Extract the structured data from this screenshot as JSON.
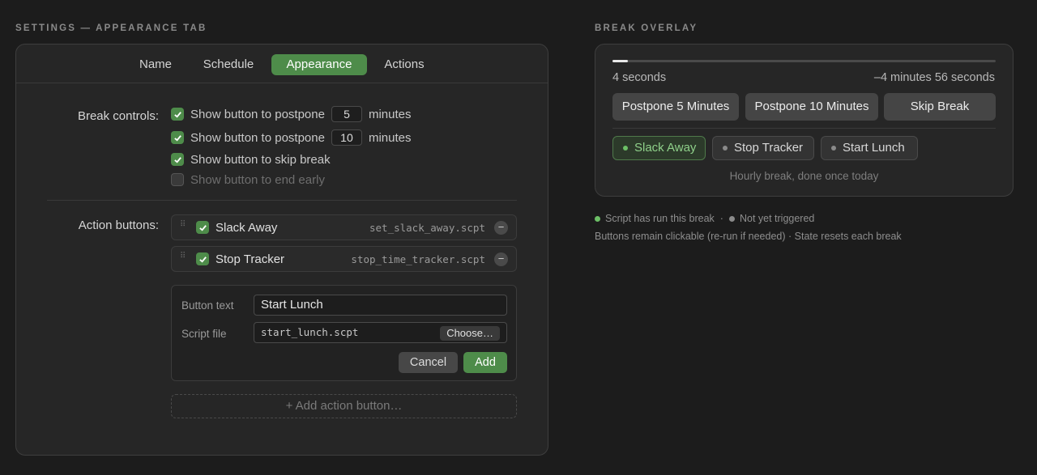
{
  "settings": {
    "section_title": "SETTINGS — APPEARANCE TAB",
    "tabs": [
      {
        "label": "Name"
      },
      {
        "label": "Schedule"
      },
      {
        "label": "Appearance",
        "active": true
      },
      {
        "label": "Actions"
      }
    ],
    "break_controls": {
      "label": "Break controls:",
      "rows": [
        {
          "prefix": "Show button to postpone",
          "value": "5",
          "suffix": "minutes",
          "checked": true
        },
        {
          "prefix": "Show button to postpone",
          "value": "10",
          "suffix": "minutes",
          "checked": true
        },
        {
          "prefix": "Show button to skip break",
          "checked": true
        },
        {
          "prefix": "Show button to end early",
          "checked": false
        }
      ]
    },
    "action_buttons": {
      "label": "Action buttons:",
      "items": [
        {
          "name": "Slack Away",
          "file": "set_slack_away.scpt",
          "checked": true
        },
        {
          "name": "Stop Tracker",
          "file": "stop_time_tracker.scpt",
          "checked": true
        }
      ],
      "form": {
        "button_text_label": "Button text",
        "button_text_value": "Start Lunch",
        "script_file_label": "Script file",
        "script_file_value": "start_lunch.scpt",
        "choose_label": "Choose…",
        "cancel_label": "Cancel",
        "add_label": "Add"
      },
      "add_action_label": "+ Add action button…"
    }
  },
  "overlay": {
    "section_title": "BREAK OVERLAY",
    "progress_fraction": 0.04,
    "elapsed": "4 seconds",
    "remaining": "–4 minutes 56 seconds",
    "buttons": [
      "Postpone 5 Minutes",
      "Postpone 10 Minutes",
      "Skip Break"
    ],
    "actions": [
      {
        "label": "Slack Away",
        "state": "run"
      },
      {
        "label": "Stop Tracker",
        "state": "idle"
      },
      {
        "label": "Start Lunch",
        "state": "idle"
      }
    ],
    "footer": "Hourly break, done once today",
    "legend": {
      "run": "Script has run this break",
      "separator": "·",
      "idle": "Not yet triggered",
      "note": "Buttons remain clickable (re-run if needed) · State resets each break"
    },
    "colors": {
      "accent": "#4e8c4a",
      "run_dot": "#6cbf66",
      "idle_dot": "#8a8a8a"
    }
  }
}
